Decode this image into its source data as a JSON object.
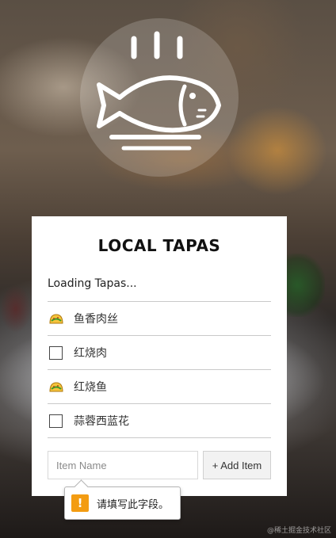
{
  "app": {
    "title": "LOCAL TAPAS",
    "logo_icon": "steaming-fish-on-plate-icon"
  },
  "list": {
    "status": "Loading Tapas...",
    "items": [
      {
        "name": "鱼香肉丝",
        "checked": true,
        "icon": "taco-emoji-icon"
      },
      {
        "name": "红烧肉",
        "checked": false,
        "icon": "checkbox-icon"
      },
      {
        "name": "红烧鱼",
        "checked": true,
        "icon": "taco-emoji-icon"
      },
      {
        "name": "蒜蓉西蓝花",
        "checked": false,
        "icon": "checkbox-icon"
      }
    ]
  },
  "form": {
    "item_value": "",
    "item_placeholder": "Item Name",
    "add_label": "+ Add Item"
  },
  "validation": {
    "message": "请填写此字段。",
    "icon_glyph": "!",
    "icon": "warning-icon",
    "color": "#f39c12"
  },
  "watermark": "@稀土掘金技术社区"
}
